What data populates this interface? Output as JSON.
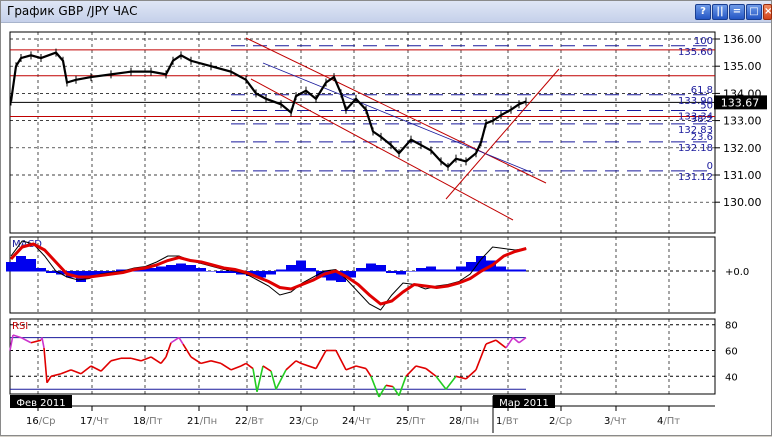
{
  "window": {
    "title": "График GBP /JPY  ЧАС",
    "buttons": [
      "?",
      "||",
      "=",
      "□",
      "×"
    ]
  },
  "chart_data": [
    {
      "type": "line",
      "name": "price",
      "title": "GBP/JPY H1",
      "y_ticks": [
        "136.00",
        "135.00",
        "134.00",
        "133.00",
        "132.00",
        "131.00",
        "130.00"
      ],
      "y_tick_values": [
        136,
        135,
        134,
        133,
        132,
        131,
        130
      ],
      "ylim": [
        129.5,
        136.3
      ],
      "current_price": "133.67",
      "current_value": 133.67,
      "x": [
        0,
        1,
        2,
        3,
        4,
        5,
        6,
        7,
        8,
        9,
        10,
        11,
        12,
        13,
        14,
        15,
        16,
        17,
        18,
        19,
        20,
        21,
        22,
        23,
        24,
        25,
        26,
        27,
        28,
        29,
        30,
        31,
        32,
        33,
        34,
        35,
        36,
        37,
        38,
        39,
        40,
        41,
        42,
        43,
        44,
        45,
        46,
        47,
        48,
        49,
        50,
        51,
        52,
        53,
        54
      ],
      "xpos": [
        10,
        15,
        20,
        30,
        40,
        55,
        62,
        66,
        75,
        90,
        110,
        130,
        150,
        165,
        172,
        180,
        190,
        210,
        230,
        245,
        255,
        265,
        280,
        290,
        295,
        305,
        315,
        325,
        333,
        340,
        345,
        355,
        365,
        372,
        380,
        390,
        398,
        410,
        420,
        430,
        440,
        447,
        455,
        465,
        475,
        480,
        485,
        492,
        500,
        510,
        518,
        525
      ],
      "values": [
        133.7,
        135.0,
        135.3,
        135.4,
        135.3,
        135.5,
        135.2,
        134.4,
        134.5,
        134.6,
        134.7,
        134.8,
        134.8,
        134.7,
        135.2,
        135.4,
        135.2,
        135.0,
        134.8,
        134.5,
        134.0,
        133.8,
        133.6,
        133.3,
        133.9,
        134.1,
        133.8,
        134.4,
        134.6,
        134.0,
        133.4,
        133.8,
        133.4,
        132.6,
        132.4,
        132.1,
        131.8,
        132.3,
        132.1,
        131.9,
        131.5,
        131.3,
        131.6,
        131.5,
        131.8,
        132.2,
        132.9,
        133.0,
        133.2,
        133.4,
        133.6,
        133.7
      ],
      "horizontal_levels": [
        135.6,
        134.65,
        133.15
      ],
      "fibonacci": [
        {
          "label": "100",
          "price_label": "135.60",
          "value": 135.75
        },
        {
          "label": "61.8",
          "price_label": "133.90",
          "value": 133.95
        },
        {
          "label": "50",
          "price_label": "133.34",
          "value": 133.37
        },
        {
          "label": "38.2",
          "price_label": "132.83",
          "value": 132.88
        },
        {
          "label": "23.6",
          "price_label": "132.18",
          "value": 132.22
        },
        {
          "label": "0",
          "price_label": "131.12",
          "value": 131.15
        }
      ]
    },
    {
      "type": "bar",
      "name": "MACD",
      "label": "MACD",
      "zero_label": "+0.0",
      "xpos": [
        10,
        20,
        30,
        40,
        50,
        60,
        70,
        80,
        90,
        100,
        110,
        120,
        130,
        140,
        150,
        160,
        170,
        180,
        190,
        200,
        210,
        220,
        230,
        240,
        250,
        260,
        270,
        280,
        290,
        300,
        310,
        320,
        330,
        340,
        350,
        360,
        370,
        380,
        390,
        400,
        410,
        420,
        430,
        440,
        450,
        460,
        470,
        480,
        490,
        500,
        510,
        520
      ],
      "histogram": [
        0.3,
        0.5,
        0.4,
        0.1,
        -0.05,
        -0.1,
        -0.2,
        -0.35,
        -0.2,
        -0.1,
        -0.05,
        0.05,
        0.05,
        0.1,
        0.1,
        0.15,
        0.2,
        0.25,
        0.2,
        0.1,
        0.0,
        -0.05,
        -0.05,
        -0.1,
        -0.15,
        -0.2,
        -0.1,
        0.05,
        0.2,
        0.35,
        0.1,
        -0.2,
        -0.3,
        -0.35,
        -0.2,
        0.1,
        0.25,
        0.2,
        -0.05,
        -0.1,
        0.0,
        0.1,
        0.15,
        0.05,
        0.05,
        0.15,
        0.3,
        0.5,
        0.35,
        0.15,
        0.05,
        0.05
      ],
      "signal": [
        0.4,
        0.8,
        0.9,
        0.7,
        0.3,
        -0.1,
        -0.2,
        -0.2,
        -0.15,
        -0.1,
        -0.05,
        0.05,
        0.1,
        0.2,
        0.35,
        0.45,
        0.35,
        0.3,
        0.2,
        0.1,
        0.05,
        -0.05,
        -0.2,
        -0.35,
        -0.55,
        -0.6,
        -0.45,
        -0.3,
        -0.1,
        0.0,
        -0.2,
        -0.45,
        -0.8,
        -1.1,
        -1.0,
        -0.7,
        -0.45,
        -0.5,
        -0.55,
        -0.5,
        -0.4,
        -0.25,
        0.0,
        0.2,
        0.5,
        0.65,
        0.75
      ],
      "macd": [
        0.5,
        1.0,
        0.9,
        0.5,
        0.0,
        -0.2,
        -0.3,
        -0.25,
        -0.1,
        -0.05,
        0.0,
        0.1,
        0.15,
        0.3,
        0.5,
        0.5,
        0.35,
        0.25,
        0.15,
        0.05,
        0.0,
        -0.1,
        -0.3,
        -0.5,
        -0.8,
        -0.7,
        -0.4,
        -0.2,
        0.0,
        0.05,
        -0.3,
        -0.7,
        -1.1,
        -1.3,
        -0.8,
        -0.4,
        -0.45,
        -0.6,
        -0.5,
        -0.45,
        -0.35,
        -0.1,
        0.4,
        0.8,
        0.75,
        0.7,
        0.75
      ]
    },
    {
      "type": "line",
      "name": "RSI",
      "label": "RSI",
      "y_ticks": [
        "80",
        "60",
        "40"
      ],
      "y_tick_values": [
        80,
        60,
        40
      ],
      "levels": [
        70,
        30
      ],
      "xpos": [
        9,
        12,
        20,
        30,
        40,
        41,
        43,
        46,
        50,
        60,
        70,
        80,
        90,
        100,
        110,
        120,
        130,
        140,
        150,
        160,
        165,
        170,
        178,
        182,
        190,
        200,
        210,
        220,
        230,
        240,
        245,
        252,
        256,
        262,
        270,
        275,
        285,
        295,
        300,
        315,
        325,
        335,
        345,
        355,
        365,
        370,
        378,
        385,
        392,
        398,
        405,
        415,
        425,
        435,
        445,
        455,
        465,
        475,
        485,
        495,
        505,
        512,
        518,
        525
      ],
      "values": [
        60,
        72,
        70,
        66,
        68,
        70,
        62,
        35,
        40,
        42,
        45,
        42,
        48,
        44,
        52,
        54,
        54,
        52,
        55,
        50,
        55,
        66,
        70,
        65,
        55,
        50,
        52,
        50,
        45,
        48,
        50,
        46,
        28,
        48,
        44,
        30,
        45,
        52,
        50,
        46,
        60,
        60,
        45,
        48,
        46,
        40,
        24,
        33,
        32,
        25,
        40,
        48,
        46,
        40,
        30,
        40,
        38,
        45,
        65,
        68,
        62,
        70,
        66,
        70
      ]
    }
  ],
  "axis": {
    "months": [
      "Фев 2011",
      "Мар 2011"
    ],
    "dates": [
      {
        "num": "16",
        "day": "Ср"
      },
      {
        "num": "17",
        "day": "Чт"
      },
      {
        "num": "18",
        "day": "Пт"
      },
      {
        "num": "21",
        "day": "Пн"
      },
      {
        "num": "22",
        "day": "Вт"
      },
      {
        "num": "23",
        "day": "Ср"
      },
      {
        "num": "24",
        "day": "Чт"
      },
      {
        "num": "25",
        "day": "Пт"
      },
      {
        "num": "28",
        "day": "Пн"
      },
      {
        "num": "1",
        "day": "Вт"
      },
      {
        "num": "2",
        "day": "Ср"
      },
      {
        "num": "3",
        "day": "Чт"
      },
      {
        "num": "4",
        "day": "Пт"
      }
    ]
  },
  "colors": {
    "price": "#000000",
    "level": "#c00000",
    "fib": "#1a1a9c",
    "macd_hist": "#0000ee",
    "signal": "#e00000",
    "rsi": "#e00000",
    "rsi_low": "#22cc22",
    "rsi_high": "#cc33cc"
  }
}
